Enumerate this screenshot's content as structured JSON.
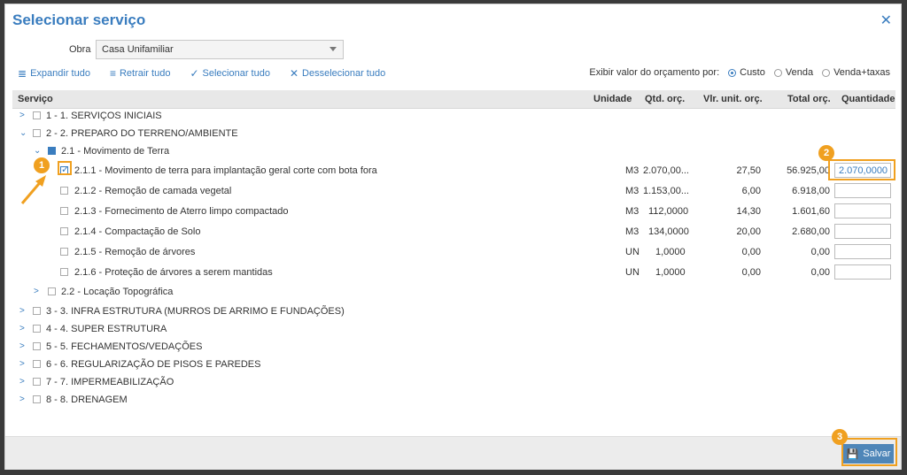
{
  "dialog": {
    "title": "Selecionar serviço"
  },
  "obra": {
    "label": "Obra",
    "value": "Casa Unifamiliar"
  },
  "toolbar": {
    "expand": "Expandir tudo",
    "collapse": "Retrair tudo",
    "select": "Selecionar tudo",
    "deselect": "Desselecionar tudo"
  },
  "exibir": {
    "label": "Exibir valor do orçamento por:",
    "options": [
      "Custo",
      "Venda",
      "Venda+taxas"
    ],
    "selected": "Custo"
  },
  "table": {
    "headers": {
      "servico": "Serviço",
      "unidade": "Unidade",
      "qtd": "Qtd. orç.",
      "vlr": "Vlr. unit. orç.",
      "total": "Total orç.",
      "quantidade": "Quantidade"
    },
    "rows": [
      {
        "label": "1 - 1. SERVIÇOS INICIAIS"
      },
      {
        "label": "2 - 2. PREPARO DO TERRENO/AMBIENTE"
      },
      {
        "label": "2.1 - Movimento de Terra"
      },
      {
        "label": "2.1.1 - Movimento de terra para implantação geral corte com bota fora",
        "unit": "M3",
        "qtd": "2.070,00...",
        "vlr": "27,50",
        "total": "56.925,00",
        "quantidade": "2.070,0000"
      },
      {
        "label": "2.1.2 - Remoção de camada vegetal",
        "unit": "M3",
        "qtd": "1.153,00...",
        "vlr": "6,00",
        "total": "6.918,00",
        "quantidade": ""
      },
      {
        "label": "2.1.3 - Fornecimento de Aterro limpo compactado",
        "unit": "M3",
        "qtd": "112,0000",
        "vlr": "14,30",
        "total": "1.601,60",
        "quantidade": ""
      },
      {
        "label": "2.1.4 - Compactação de Solo",
        "unit": "M3",
        "qtd": "134,0000",
        "vlr": "20,00",
        "total": "2.680,00",
        "quantidade": ""
      },
      {
        "label": "2.1.5 - Remoção de árvores",
        "unit": "UN",
        "qtd": "1,0000",
        "vlr": "0,00",
        "total": "0,00",
        "quantidade": ""
      },
      {
        "label": "2.1.6 - Proteção de árvores a serem mantidas",
        "unit": "UN",
        "qtd": "1,0000",
        "vlr": "0,00",
        "total": "0,00",
        "quantidade": ""
      },
      {
        "label": "2.2 - Locação Topográfica"
      },
      {
        "label": "3 - 3. INFRA ESTRUTURA (MURROS DE ARRIMO E FUNDAÇÕES)"
      },
      {
        "label": "4 - 4. SUPER ESTRUTURA"
      },
      {
        "label": "5 - 5. FECHAMENTOS/VEDAÇÕES"
      },
      {
        "label": "6 - 6. REGULARIZAÇÃO DE PISOS E PAREDES"
      },
      {
        "label": "7 - 7. IMPERMEABILIZAÇÃO"
      },
      {
        "label": "8 - 8. DRENAGEM"
      }
    ]
  },
  "footer": {
    "save": "Salvar"
  },
  "badges": [
    "1",
    "2",
    "3"
  ],
  "colors": {
    "accent": "#3a7dbf",
    "highlight": "#f0a020"
  }
}
